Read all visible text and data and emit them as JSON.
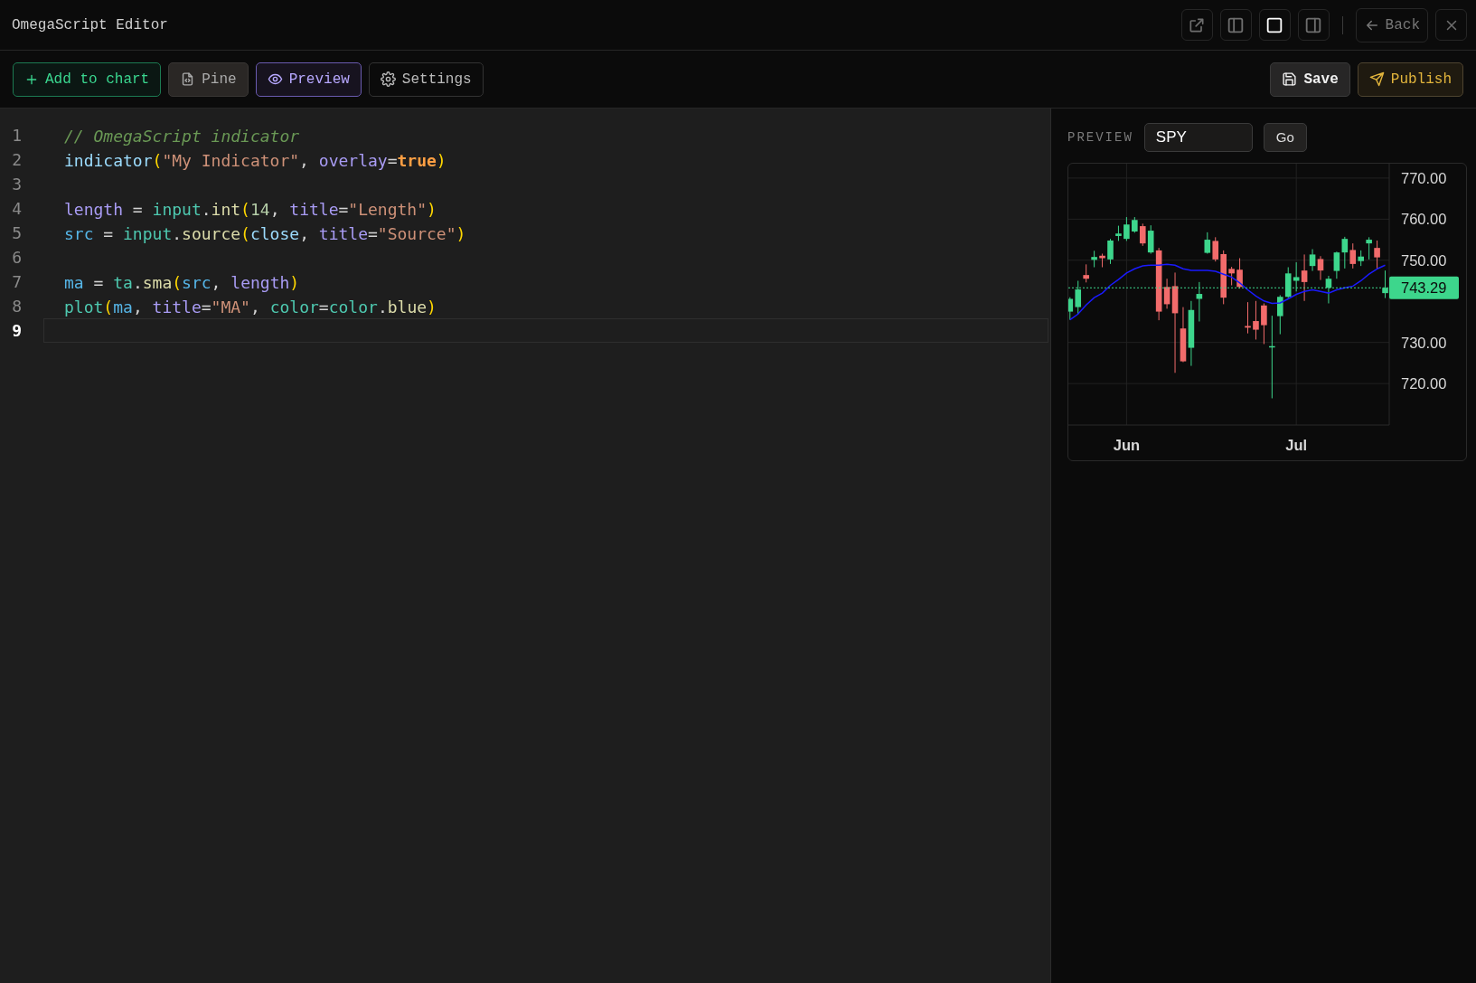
{
  "window": {
    "title": "OmegaScript Editor"
  },
  "header_actions": {
    "layout_modes": [
      {
        "kind": "left",
        "selected": false
      },
      {
        "kind": "full",
        "selected": true
      },
      {
        "kind": "right",
        "selected": false
      }
    ],
    "back": "Back"
  },
  "toolbar": {
    "left": [
      {
        "kind": "add",
        "label": "Add to chart",
        "selected": false
      },
      {
        "kind": "file",
        "label": "Pine",
        "selected": false
      },
      {
        "kind": "eye",
        "label": "Preview",
        "selected": true
      },
      {
        "kind": "gear",
        "label": "Settings",
        "selected": false
      }
    ],
    "right": [
      {
        "kind": "save",
        "label": "Save"
      },
      {
        "kind": "publish",
        "label": "Publish"
      }
    ]
  },
  "editor": {
    "lines": [
      {
        "number": "1",
        "current": false,
        "tokens": [
          {
            "text": "// OmegaScript indicator",
            "kind": "comment"
          }
        ]
      },
      {
        "number": "2",
        "current": false,
        "tokens": [
          {
            "text": "indicator",
            "kind": "func"
          },
          {
            "text": "(",
            "kind": "paren"
          },
          {
            "text": "\"My Indicator\"",
            "kind": "string"
          },
          {
            "text": ", ",
            "kind": "plain"
          },
          {
            "text": "overlay",
            "kind": "param"
          },
          {
            "text": "=",
            "kind": "plain"
          },
          {
            "text": "true",
            "kind": "bool"
          },
          {
            "text": ")",
            "kind": "paren"
          }
        ]
      },
      {
        "number": "3",
        "current": false
      },
      {
        "number": "4",
        "current": false,
        "tokens": [
          {
            "text": "length",
            "kind": "param"
          },
          {
            "text": " = ",
            "kind": "plain"
          },
          {
            "text": "input",
            "kind": "ns"
          },
          {
            "text": ".",
            "kind": "plain"
          },
          {
            "text": "int",
            "kind": "method"
          },
          {
            "text": "(",
            "kind": "paren"
          },
          {
            "text": "14",
            "kind": "number"
          },
          {
            "text": ", ",
            "kind": "plain"
          },
          {
            "text": "title",
            "kind": "param"
          },
          {
            "text": "=",
            "kind": "plain"
          },
          {
            "text": "\"Length\"",
            "kind": "string"
          },
          {
            "text": ")",
            "kind": "paren"
          }
        ]
      },
      {
        "number": "5",
        "current": false,
        "tokens": [
          {
            "text": "src",
            "kind": "var"
          },
          {
            "text": " = ",
            "kind": "plain"
          },
          {
            "text": "input",
            "kind": "ns"
          },
          {
            "text": ".",
            "kind": "plain"
          },
          {
            "text": "source",
            "kind": "method"
          },
          {
            "text": "(",
            "kind": "paren"
          },
          {
            "text": "close",
            "kind": "func"
          },
          {
            "text": ", ",
            "kind": "plain"
          },
          {
            "text": "title",
            "kind": "param"
          },
          {
            "text": "=",
            "kind": "plain"
          },
          {
            "text": "\"Source\"",
            "kind": "string"
          },
          {
            "text": ")",
            "kind": "paren"
          }
        ]
      },
      {
        "number": "6",
        "current": false
      },
      {
        "number": "7",
        "current": false,
        "tokens": [
          {
            "text": "ma",
            "kind": "var"
          },
          {
            "text": " = ",
            "kind": "plain"
          },
          {
            "text": "ta",
            "kind": "ns"
          },
          {
            "text": ".",
            "kind": "plain"
          },
          {
            "text": "sma",
            "kind": "method"
          },
          {
            "text": "(",
            "kind": "paren"
          },
          {
            "text": "src",
            "kind": "var"
          },
          {
            "text": ", ",
            "kind": "plain"
          },
          {
            "text": "length",
            "kind": "param"
          },
          {
            "text": ")",
            "kind": "paren"
          }
        ]
      },
      {
        "number": "8",
        "current": false,
        "tokens": [
          {
            "text": "plot",
            "kind": "ns"
          },
          {
            "text": "(",
            "kind": "paren"
          },
          {
            "text": "ma",
            "kind": "var"
          },
          {
            "text": ", ",
            "kind": "plain"
          },
          {
            "text": "title",
            "kind": "param"
          },
          {
            "text": "=",
            "kind": "plain"
          },
          {
            "text": "\"MA\"",
            "kind": "string"
          },
          {
            "text": ", ",
            "kind": "plain"
          },
          {
            "text": "color",
            "kind": "ns"
          },
          {
            "text": "=",
            "kind": "plain"
          },
          {
            "text": "color",
            "kind": "ns"
          },
          {
            "text": ".",
            "kind": "plain"
          },
          {
            "text": "blue",
            "kind": "method"
          },
          {
            "text": ")",
            "kind": "paren"
          }
        ]
      },
      {
        "number": "9",
        "current": true
      }
    ]
  },
  "preview": {
    "label": "PREVIEW",
    "symbol": "SPY",
    "go": "Go",
    "chart_data": {
      "type": "candlestick",
      "categories": [
        null,
        null,
        null,
        null,
        null,
        null,
        null,
        "Jun",
        null,
        null,
        null,
        null,
        null,
        null,
        null,
        null,
        null,
        null,
        null,
        null,
        null,
        null,
        null,
        null,
        null,
        null,
        null,
        null,
        "Jul",
        null,
        null,
        null,
        null,
        null,
        null,
        null,
        null,
        null,
        null,
        null
      ],
      "ylim": [
        709.9,
        773.5
      ],
      "yticks": [
        {
          "value": 720,
          "label": "720.00"
        },
        {
          "value": 730,
          "label": "730.00"
        },
        {
          "value": 750,
          "label": "750.00"
        },
        {
          "value": 760,
          "label": "760.00"
        },
        {
          "value": 770,
          "label": "770.00"
        }
      ],
      "grid": true,
      "series": [
        {
          "type": "line",
          "color": "#1a1aff",
          "values": [
            735.5,
            736.9,
            739.1,
            740.9,
            742.0,
            743.9,
            745.3,
            746.9,
            747.9,
            748.6,
            748.8,
            748.8,
            749.0,
            748.8,
            747.9,
            747.5,
            747.5,
            747.5,
            747.3,
            746.6,
            745.9,
            744.5,
            742.8,
            741.3,
            740.1,
            739.5,
            739.6,
            740.6,
            741.7,
            742.4,
            742.8,
            742.4,
            742.0,
            742.8,
            743.3,
            743.7,
            745.0,
            746.6,
            747.9,
            748.8
          ]
        }
      ],
      "ohlc": [
        [
          737.5,
          741.0,
          735.5,
          740.6
        ],
        [
          738.6,
          745.0,
          736.9,
          742.9
        ],
        [
          746.4,
          749.0,
          744.6,
          745.5
        ],
        [
          750.1,
          752.3,
          748.3,
          750.8
        ],
        [
          751.1,
          751.6,
          748.3,
          750.5
        ],
        [
          750.2,
          755.2,
          749.1,
          754.8
        ],
        [
          755.9,
          758.4,
          754.7,
          756.5
        ],
        [
          755.2,
          760.5,
          754.7,
          758.7
        ],
        [
          757.0,
          760.5,
          756.7,
          759.8
        ],
        [
          758.3,
          758.9,
          753.5,
          754.1
        ],
        [
          751.9,
          758.5,
          751.6,
          757.2
        ],
        [
          752.4,
          753.0,
          735.4,
          737.5
        ],
        [
          743.5,
          745.5,
          738.2,
          739.3
        ],
        [
          743.7,
          747.0,
          722.6,
          737.1
        ],
        [
          733.4,
          738.6,
          725.2,
          725.4
        ],
        [
          728.7,
          740.1,
          724.3,
          737.9
        ],
        [
          740.6,
          744.7,
          735.1,
          741.8
        ],
        [
          751.8,
          756.8,
          751.6,
          755.0
        ],
        [
          754.7,
          755.6,
          749.7,
          750.2
        ],
        [
          751.5,
          752.4,
          739.3,
          740.9
        ],
        [
          747.9,
          748.4,
          743.9,
          746.8
        ],
        [
          747.7,
          750.5,
          743.1,
          743.5
        ],
        [
          734.0,
          739.8,
          732.2,
          733.6
        ],
        [
          735.2,
          740.1,
          730.7,
          733.1
        ],
        [
          739.0,
          739.5,
          729.6,
          734.2
        ],
        [
          729.0,
          736.5,
          716.4,
          729.1
        ],
        [
          736.4,
          741.5,
          732.0,
          741.1
        ],
        [
          741.1,
          748.3,
          740.8,
          746.8
        ],
        [
          745.0,
          749.5,
          742.4,
          745.9
        ],
        [
          747.5,
          751.4,
          740.1,
          744.7
        ],
        [
          748.6,
          752.7,
          747.4,
          751.4
        ],
        [
          750.3,
          751.0,
          745.2,
          747.5
        ],
        [
          743.3,
          746.2,
          739.5,
          745.5
        ],
        [
          747.4,
          752.1,
          745.5,
          751.9
        ],
        [
          751.9,
          755.7,
          748.0,
          755.2
        ],
        [
          752.5,
          754.1,
          748.0,
          749.1
        ],
        [
          749.8,
          752.4,
          748.6,
          750.9
        ],
        [
          754.1,
          755.6,
          750.2,
          755.0
        ],
        [
          753.0,
          754.8,
          747.9,
          750.7
        ],
        [
          742.0,
          747.5,
          740.8,
          743.3
        ]
      ],
      "ref_lines": [
        {
          "axis": "y",
          "value": 743.29,
          "color": "#3dd68c"
        }
      ],
      "annotations": [
        "743.29"
      ]
    }
  }
}
